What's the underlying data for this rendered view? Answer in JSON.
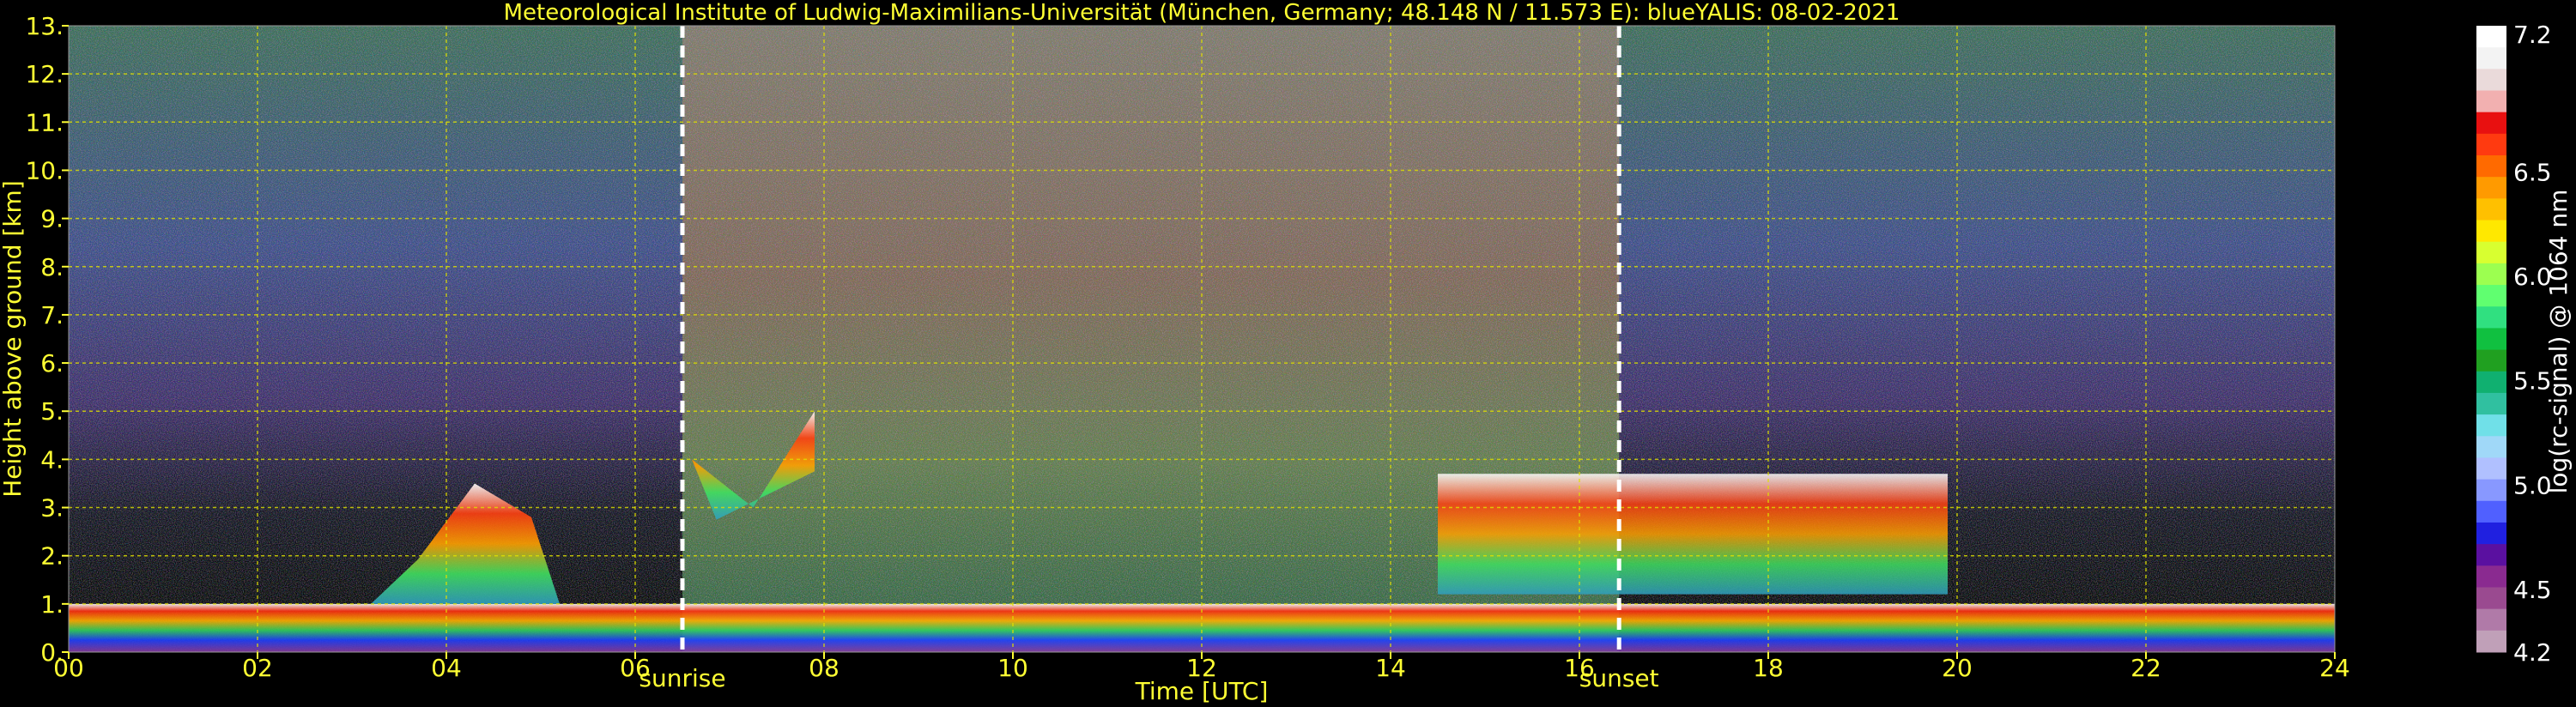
{
  "chart_data": {
    "type": "heatmap",
    "title": "Meteorological Institute of Ludwig-Maximilians-Universität (München, Germany; 48.148 N / 11.573 E):     blueYALIS: 08-02-2021",
    "xlabel": "Time [UTC]",
    "ylabel": "Height above ground [km]",
    "xlim": [
      0,
      24
    ],
    "ylim": [
      0,
      13
    ],
    "x_ticks": [
      "00",
      "02",
      "04",
      "06",
      "08",
      "10",
      "12",
      "14",
      "16",
      "18",
      "20",
      "22",
      "24"
    ],
    "y_ticks": [
      "0.",
      "1.",
      "2.",
      "3.",
      "4.",
      "5.",
      "6.",
      "7.",
      "8.",
      "9.",
      "10.",
      "11.",
      "12.",
      "13."
    ],
    "grid": true,
    "markers": [
      {
        "label": "sunrise",
        "x": 6.5
      },
      {
        "label": "sunset",
        "x": 16.42
      }
    ],
    "colorbar": {
      "label": "log(rc-signal) @ 1064 nm",
      "range": [
        4.2,
        7.2
      ],
      "ticks": [
        "7.2",
        "6.5",
        "6.0",
        "5.5",
        "5.0",
        "4.5",
        "4.2"
      ],
      "tick_values": [
        7.2,
        6.5,
        6.0,
        5.5,
        5.0,
        4.5,
        4.2
      ],
      "colors": [
        "#ffffff",
        "#f3f3f3",
        "#eadada",
        "#f2b0b0",
        "#e81010",
        "#ff3a10",
        "#ff6a00",
        "#ff9a00",
        "#ffc000",
        "#ffe800",
        "#d8ff30",
        "#9cff50",
        "#60ff70",
        "#30e080",
        "#10c040",
        "#20a020",
        "#10b070",
        "#30c0a0",
        "#70e0e8",
        "#a0d8f8",
        "#b0c0ff",
        "#8898ff",
        "#5060ff",
        "#2020e0",
        "#5a10a0",
        "#8a2a90",
        "#9a4a90",
        "#b07aa8",
        "#c0a0b8"
      ]
    },
    "features": [
      {
        "name": "boundary-layer",
        "t_start": 0,
        "t_end": 24,
        "top_km": 1.0
      },
      {
        "name": "aerosol-layer",
        "t_start": 3.2,
        "t_end": 5.2,
        "top_km": 3.5
      },
      {
        "name": "cloud-layer",
        "t_start": 14.5,
        "t_end": 19.9,
        "top_km": 3.7
      },
      {
        "name": "cloud-patch",
        "t_start": 6.6,
        "t_end": 7.9,
        "top_km": 5.0
      },
      {
        "name": "daylight-noise",
        "t_start": 6.5,
        "t_end": 16.42
      }
    ]
  }
}
